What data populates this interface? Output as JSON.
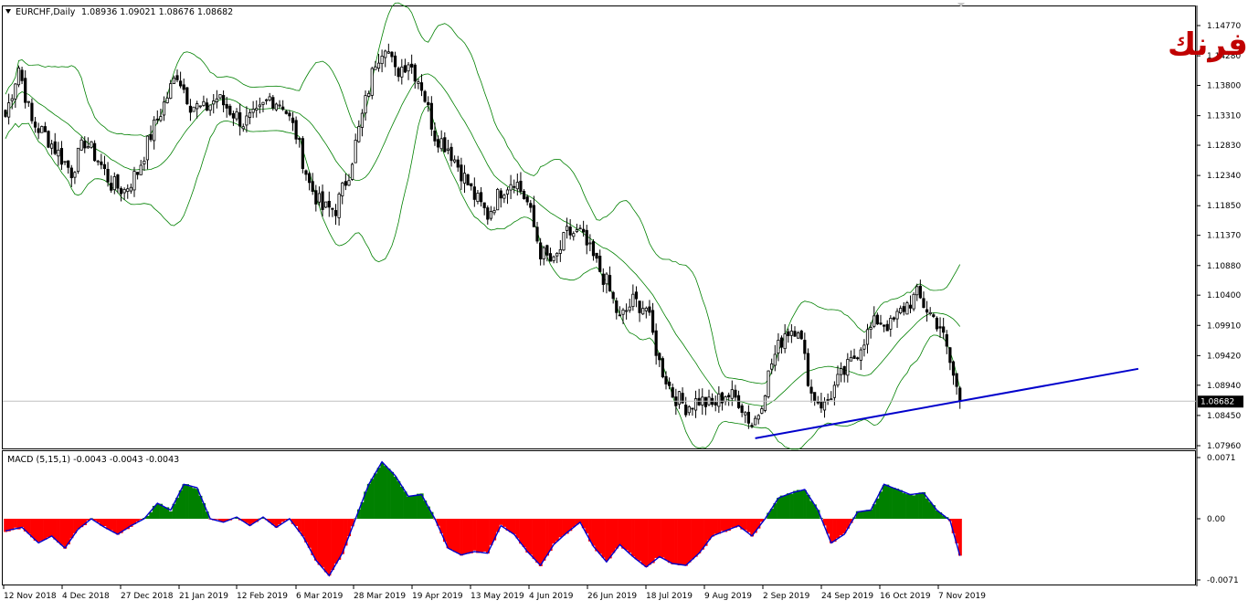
{
  "chart_header": {
    "symbol_timeframe": "EURCHF,Daily",
    "ohlc": "1.08936 1.09021 1.08676 1.08682"
  },
  "watermark": {
    "text": "اليورو فرنك",
    "color": "#c00000"
  },
  "macd_header": {
    "text": "MACD (5,15,1) -0.0043 -0.0043 -0.0043"
  },
  "chart_data": [
    {
      "type": "candlestick",
      "symbol": "EURCHF",
      "timeframe": "Daily",
      "y_ticks": [
        "1.14770",
        "1.14280",
        "1.13800",
        "1.13310",
        "1.12830",
        "1.12340",
        "1.11850",
        "1.11370",
        "1.10880",
        "1.10400",
        "1.09910",
        "1.09420",
        "1.08940",
        "1.08450",
        "1.07960"
      ],
      "ylim": [
        1.0796,
        1.1477
      ],
      "x_ticks": [
        "12 Nov 2018",
        "4 Dec 2018",
        "27 Dec 2018",
        "21 Jan 2019",
        "12 Feb 2019",
        "6 Mar 2019",
        "28 Mar 2019",
        "19 Apr 2019",
        "13 May 2019",
        "4 Jun 2019",
        "26 Jun 2019",
        "18 Jul 2019",
        "9 Aug 2019",
        "2 Sep 2019",
        "24 Sep 2019",
        "16 Oct 2019",
        "7 Nov 2019"
      ],
      "last_price_label": "1.08682",
      "last_price": 1.08682,
      "colors": {
        "candles": "#000000",
        "bollinger": "#008000",
        "trendline": "#0000cc",
        "price_line": "#c0c0c0"
      },
      "trendline": {
        "start": [
          "2 Sep 2019",
          1.0808
        ],
        "end_projection": true,
        "color": "#0000cc"
      },
      "close_anchors": [
        [
          0,
          1.133
        ],
        [
          4,
          1.141
        ],
        [
          8,
          1.132
        ],
        [
          12,
          1.13
        ],
        [
          16,
          1.127
        ],
        [
          20,
          1.124
        ],
        [
          24,
          1.129
        ],
        [
          28,
          1.126
        ],
        [
          32,
          1.122
        ],
        [
          36,
          1.121
        ],
        [
          40,
          1.124
        ],
        [
          44,
          1.13
        ],
        [
          48,
          1.135
        ],
        [
          52,
          1.14
        ],
        [
          56,
          1.135
        ],
        [
          60,
          1.134
        ],
        [
          64,
          1.136
        ],
        [
          68,
          1.134
        ],
        [
          72,
          1.132
        ],
        [
          76,
          1.133
        ],
        [
          80,
          1.136
        ],
        [
          84,
          1.135
        ],
        [
          88,
          1.13
        ],
        [
          92,
          1.122
        ],
        [
          96,
          1.118
        ],
        [
          100,
          1.118
        ],
        [
          104,
          1.124
        ],
        [
          108,
          1.133
        ],
        [
          112,
          1.142
        ],
        [
          115,
          1.145
        ],
        [
          118,
          1.14
        ],
        [
          122,
          1.142
        ],
        [
          126,
          1.138
        ],
        [
          130,
          1.13
        ],
        [
          134,
          1.128
        ],
        [
          138,
          1.124
        ],
        [
          142,
          1.12
        ],
        [
          146,
          1.117
        ],
        [
          150,
          1.121
        ],
        [
          154,
          1.123
        ],
        [
          158,
          1.119
        ],
        [
          162,
          1.111
        ],
        [
          166,
          1.109
        ],
        [
          170,
          1.114
        ],
        [
          174,
          1.114
        ],
        [
          178,
          1.11
        ],
        [
          182,
          1.106
        ],
        [
          186,
          1.1
        ],
        [
          190,
          1.103
        ],
        [
          194,
          1.102
        ],
        [
          198,
          1.093
        ],
        [
          202,
          1.088
        ],
        [
          206,
          1.086
        ],
        [
          210,
          1.087
        ],
        [
          214,
          1.086
        ],
        [
          218,
          1.088
        ],
        [
          222,
          1.087
        ],
        [
          226,
          1.083
        ],
        [
          228,
          1.085
        ],
        [
          232,
          1.093
        ],
        [
          236,
          1.098
        ],
        [
          240,
          1.099
        ],
        [
          244,
          1.088
        ],
        [
          248,
          1.086
        ],
        [
          252,
          1.09
        ],
        [
          256,
          1.093
        ],
        [
          260,
          1.097
        ],
        [
          264,
          1.1
        ],
        [
          268,
          1.099
        ],
        [
          272,
          1.102
        ],
        [
          276,
          1.104
        ],
        [
          280,
          1.101
        ],
        [
          283,
          1.099
        ],
        [
          286,
          1.093
        ],
        [
          289,
          1.0868
        ]
      ]
    },
    {
      "type": "bar",
      "title": "MACD (5,15,1)",
      "value": -0.0043,
      "y_ticks": [
        "0.0071",
        "0.00",
        "-0.0071"
      ],
      "ylim": [
        -0.0071,
        0.0071
      ],
      "colors": {
        "positive": "#008000",
        "negative": "#ff0000",
        "line": "#0000cc"
      },
      "series": [
        {
          "name": "MACD",
          "values": [
            [
              0,
              -0.0014
            ],
            [
              5,
              -0.001
            ],
            [
              10,
              -0.0028
            ],
            [
              14,
              -0.002
            ],
            [
              18,
              -0.0034
            ],
            [
              22,
              -0.0012
            ],
            [
              26,
              0.0
            ],
            [
              30,
              -0.001
            ],
            [
              34,
              -0.0018
            ],
            [
              38,
              -0.0008
            ],
            [
              42,
              0.0
            ],
            [
              46,
              0.0018
            ],
            [
              50,
              0.001
            ],
            [
              54,
              0.004
            ],
            [
              58,
              0.0036
            ],
            [
              62,
              0.0
            ],
            [
              66,
              -0.0004
            ],
            [
              70,
              0.0002
            ],
            [
              74,
              -0.0008
            ],
            [
              78,
              0.0002
            ],
            [
              82,
              -0.001
            ],
            [
              86,
              0.0
            ],
            [
              90,
              -0.002
            ],
            [
              94,
              -0.0048
            ],
            [
              98,
              -0.0066
            ],
            [
              102,
              -0.004
            ],
            [
              106,
              0.0
            ],
            [
              110,
              0.004
            ],
            [
              114,
              0.0066
            ],
            [
              118,
              0.005
            ],
            [
              122,
              0.0026
            ],
            [
              126,
              0.0028
            ],
            [
              130,
              0.0
            ],
            [
              134,
              -0.0034
            ],
            [
              138,
              -0.0042
            ],
            [
              142,
              -0.0038
            ],
            [
              146,
              -0.004
            ],
            [
              150,
              -0.0008
            ],
            [
              154,
              -0.0018
            ],
            [
              158,
              -0.0038
            ],
            [
              162,
              -0.0054
            ],
            [
              166,
              -0.003
            ],
            [
              170,
              -0.0016
            ],
            [
              174,
              -0.0004
            ],
            [
              178,
              -0.0032
            ],
            [
              182,
              -0.005
            ],
            [
              186,
              -0.003
            ],
            [
              190,
              -0.0044
            ],
            [
              194,
              -0.0056
            ],
            [
              198,
              -0.0044
            ],
            [
              202,
              -0.0052
            ],
            [
              206,
              -0.0054
            ],
            [
              210,
              -0.004
            ],
            [
              214,
              -0.002
            ],
            [
              218,
              -0.0014
            ],
            [
              222,
              -0.0008
            ],
            [
              226,
              -0.002
            ],
            [
              230,
              0.0
            ],
            [
              234,
              0.0024
            ],
            [
              238,
              0.003
            ],
            [
              242,
              0.0034
            ],
            [
              246,
              0.001
            ],
            [
              250,
              -0.0028
            ],
            [
              254,
              -0.0018
            ],
            [
              258,
              0.0008
            ],
            [
              262,
              0.001
            ],
            [
              266,
              0.004
            ],
            [
              270,
              0.0034
            ],
            [
              274,
              0.0028
            ],
            [
              278,
              0.003
            ],
            [
              282,
              0.001
            ],
            [
              286,
              -0.0002
            ],
            [
              289,
              -0.0043
            ]
          ]
        }
      ]
    }
  ]
}
